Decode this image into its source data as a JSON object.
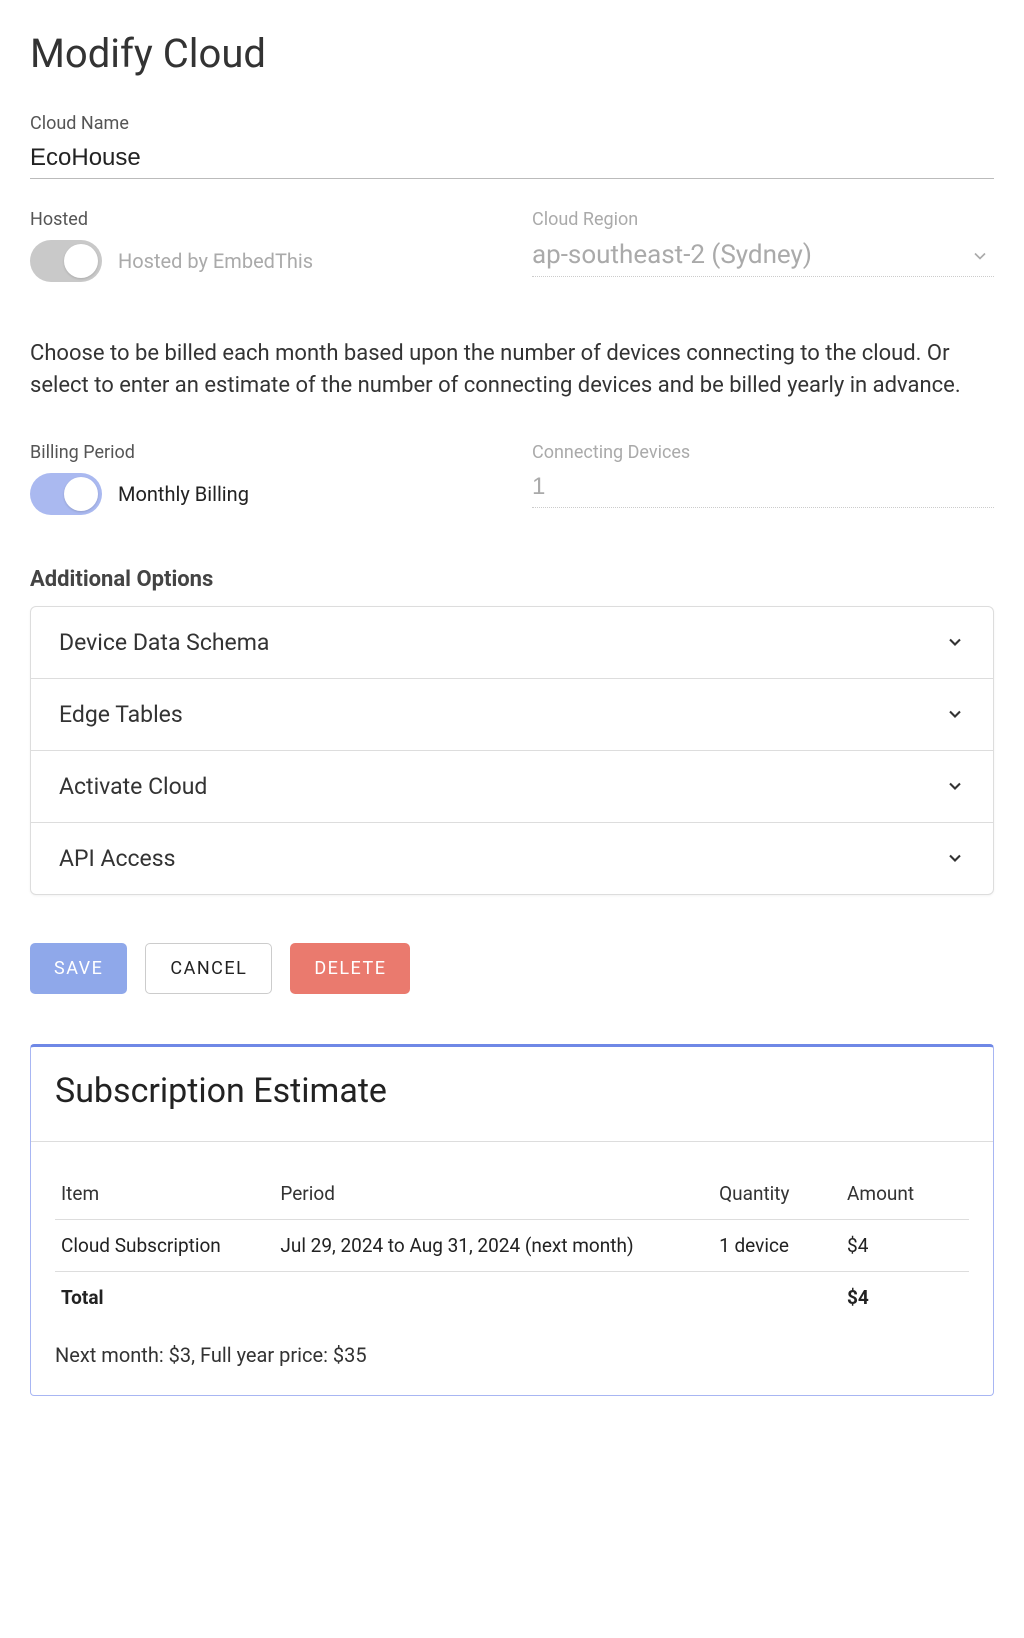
{
  "title": "Modify Cloud",
  "cloud_name": {
    "label": "Cloud Name",
    "value": "EcoHouse"
  },
  "hosted": {
    "label": "Hosted",
    "text": "Hosted by EmbedThis",
    "on": true
  },
  "region": {
    "label": "Cloud Region",
    "value": "ap-southeast-2 (Sydney)"
  },
  "billing_desc": "Choose to be billed each month based upon the number of devices connecting to the cloud. Or select to enter an estimate of the number of connecting devices and be billed yearly in advance.",
  "billing_period": {
    "label": "Billing Period",
    "text": "Monthly Billing",
    "on": true
  },
  "devices": {
    "label": "Connecting Devices",
    "value": "1"
  },
  "additional_options_label": "Additional Options",
  "options": [
    {
      "label": "Device Data Schema"
    },
    {
      "label": "Edge Tables"
    },
    {
      "label": "Activate Cloud"
    },
    {
      "label": "API Access"
    }
  ],
  "buttons": {
    "save": "SAVE",
    "cancel": "CANCEL",
    "delete": "DELETE"
  },
  "estimate": {
    "title": "Subscription Estimate",
    "headers": {
      "item": "Item",
      "period": "Period",
      "quantity": "Quantity",
      "amount": "Amount"
    },
    "rows": [
      {
        "item": "Cloud Subscription",
        "period": "Jul 29, 2024 to Aug 31, 2024 (next month)",
        "quantity": "1 device",
        "amount": "$4"
      }
    ],
    "total_label": "Total",
    "total_amount": "$4",
    "note": "Next month: $3, Full year price: $35"
  }
}
